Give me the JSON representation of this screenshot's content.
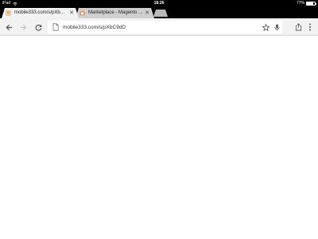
{
  "status_bar": {
    "device": "iPad",
    "time": "18:26",
    "battery_text": "77%",
    "battery_level": 0.77
  },
  "tabs": [
    {
      "title": "mobile333.com/s/pXbC9dD",
      "active": true,
      "favicon": "doc-icon"
    },
    {
      "title": "Marketplace - Magento Comm",
      "active": false,
      "favicon": "magento-icon"
    }
  ],
  "toolbar": {
    "url": "mobile333.com/s/pXbC9dD",
    "back_icon": "back-arrow-icon",
    "forward_icon": "forward-arrow-icon",
    "reload_icon": "reload-icon",
    "star_icon": "star-icon",
    "mic_icon": "mic-icon",
    "share_icon": "share-icon",
    "menu_icon": "menu-icon"
  }
}
